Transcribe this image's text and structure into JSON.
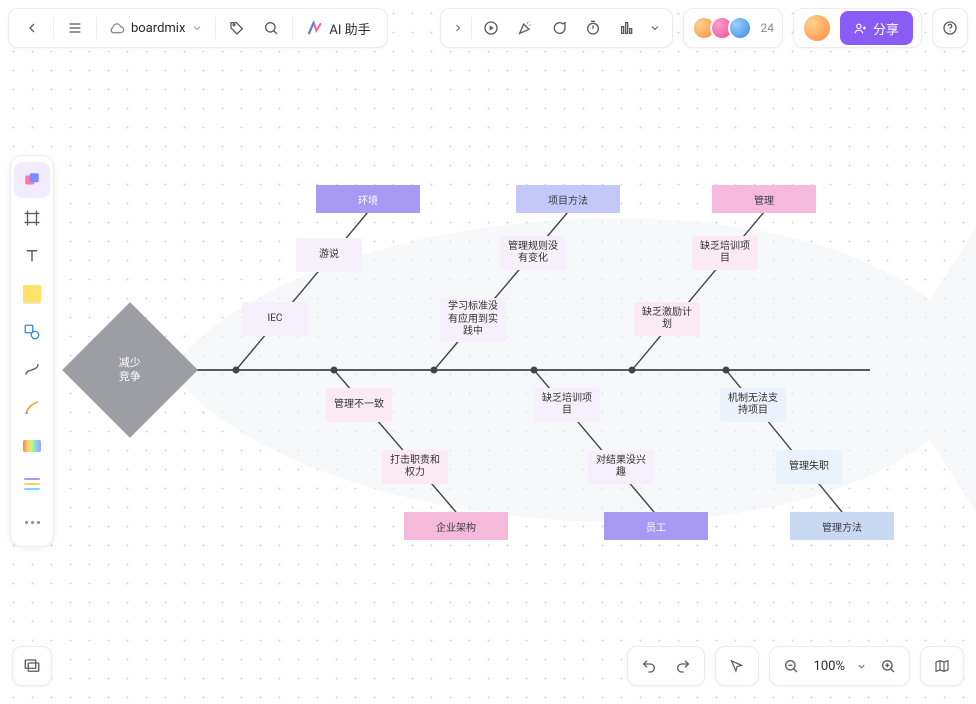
{
  "header": {
    "file_name": "boardmix",
    "ai_label": "AI 助手",
    "share_label": "分享",
    "presence_count": "24"
  },
  "bottom": {
    "zoom_label": "100%"
  },
  "fishbone": {
    "head": "减少\n竞争",
    "top_categories": {
      "env": {
        "label": "环境",
        "color": "cat-purple"
      },
      "method": {
        "label": "项目方法",
        "color": "cat-lilac"
      },
      "mgmt": {
        "label": "管理",
        "color": "cat-pink"
      }
    },
    "bottom_categories": {
      "org": {
        "label": "企业架构",
        "color": "cat-pink"
      },
      "staff": {
        "label": "员工",
        "color": "cat-purple"
      },
      "mmethod": {
        "label": "管理方法",
        "color": "cat-blue"
      }
    },
    "causes_top": {
      "env_1": "游说",
      "env_2": "IEC",
      "method_1": "管理规则没有变化",
      "method_2": "学习标准没有应用到实践中",
      "mgmt_1": "缺乏培训项目",
      "mgmt_2": "缺乏激励计划"
    },
    "causes_bottom": {
      "org_1": "管理不一致",
      "org_2": "打击职责和权力",
      "staff_1": "缺乏培训项目",
      "staff_2": "对结果没兴趣",
      "mmethod_1": "机制无法支持项目",
      "mmethod_2": "管理失职"
    }
  }
}
